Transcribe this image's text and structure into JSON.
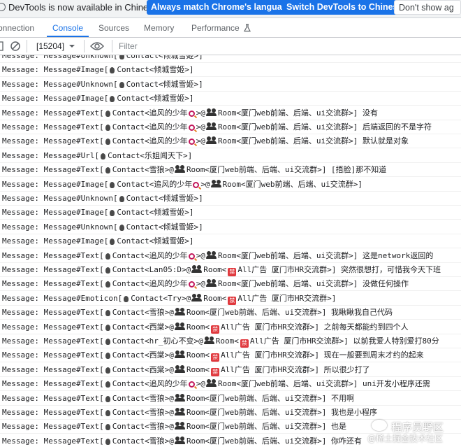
{
  "infobar": {
    "message": "DevTools is now available in Chinese!",
    "btn_match": "Always match Chrome's language",
    "btn_switch": "Switch DevTools to Chinese",
    "btn_dont": "Don't show ag"
  },
  "tabs": [
    {
      "label": "onnection"
    },
    {
      "label": "Console",
      "active": true
    },
    {
      "label": "Sources"
    },
    {
      "label": "Memory"
    },
    {
      "label": "Performance"
    }
  ],
  "toolbar": {
    "context": "[15204]",
    "filter_placeholder": "Filter"
  },
  "console_rows": [
    [
      {
        "t": "Message: Message#Unknown["
      },
      {
        "i": "bubble"
      },
      {
        "t": "Contact<倾城雪姬>]"
      }
    ],
    [
      {
        "t": "Message: Message#Image["
      },
      {
        "i": "bubble"
      },
      {
        "t": "Contact<倾城雪姬>]"
      }
    ],
    [
      {
        "t": "Message: Message#Unknown["
      },
      {
        "i": "bubble"
      },
      {
        "t": "Contact<倾城雪姬>]"
      }
    ],
    [
      {
        "t": "Message: Message#Image["
      },
      {
        "i": "bubble"
      },
      {
        "t": "Contact<倾城雪姬>]"
      }
    ],
    [
      {
        "t": "Message: Message#Text["
      },
      {
        "i": "bubble"
      },
      {
        "t": "Contact<追风的少年"
      },
      {
        "i": "mag"
      },
      {
        "t": ">@"
      },
      {
        "i": "group"
      },
      {
        "t": "Room<厦门web前端、后端、ui交流群>]     没有"
      }
    ],
    [
      {
        "t": "Message: Message#Text["
      },
      {
        "i": "bubble"
      },
      {
        "t": "Contact<追风的少年"
      },
      {
        "i": "mag"
      },
      {
        "t": ">@"
      },
      {
        "i": "group"
      },
      {
        "t": "Room<厦门web前端、后端、ui交流群>]     后端返回的不是字符"
      }
    ],
    [
      {
        "t": "Message: Message#Text["
      },
      {
        "i": "bubble"
      },
      {
        "t": "Contact<追风的少年"
      },
      {
        "i": "mag"
      },
      {
        "t": ">@"
      },
      {
        "i": "group"
      },
      {
        "t": "Room<厦门web前端、后端、ui交流群>]     默认就是对象"
      }
    ],
    [
      {
        "t": "Message: Message#Url["
      },
      {
        "i": "bubble"
      },
      {
        "t": "Contact<乐姐闻天下>]"
      }
    ],
    [
      {
        "t": "Message: Message#Text["
      },
      {
        "i": "bubble"
      },
      {
        "t": "Contact<雪狼>@"
      },
      {
        "i": "group"
      },
      {
        "t": "Room<厦门web前端、后端、ui交流群>]     [捂脸]那不知道"
      }
    ],
    [
      {
        "t": "Message: Message#Image["
      },
      {
        "i": "bubble"
      },
      {
        "t": "Contact<追风的少年"
      },
      {
        "i": "mag"
      },
      {
        "t": ">@"
      },
      {
        "i": "group"
      },
      {
        "t": "Room<厦门web前端、后端、ui交流群>]"
      }
    ],
    [
      {
        "t": "Message: Message#Unknown["
      },
      {
        "i": "bubble"
      },
      {
        "t": "Contact<倾城雪姬>]"
      }
    ],
    [
      {
        "t": "Message: Message#Image["
      },
      {
        "i": "bubble"
      },
      {
        "t": "Contact<倾城雪姬>]"
      }
    ],
    [
      {
        "t": "Message: Message#Unknown["
      },
      {
        "i": "bubble"
      },
      {
        "t": "Contact<倾城雪姬>]"
      }
    ],
    [
      {
        "t": "Message: Message#Image["
      },
      {
        "i": "bubble"
      },
      {
        "t": "Contact<倾城雪姬>]"
      }
    ],
    [
      {
        "t": "Message: Message#Text["
      },
      {
        "i": "bubble"
      },
      {
        "t": "Contact<追风的少年"
      },
      {
        "i": "mag"
      },
      {
        "t": ">@"
      },
      {
        "i": "group"
      },
      {
        "t": "Room<厦门web前端、后端、ui交流群>]     这是network返回的"
      }
    ],
    [
      {
        "t": "Message: Message#Text["
      },
      {
        "i": "bubble"
      },
      {
        "t": "Contact<Lan05:D>@"
      },
      {
        "i": "group"
      },
      {
        "t": "Room<"
      },
      {
        "i": "ban"
      },
      {
        "t": "All广告 厦门市HR交流群>]     突然很想打，可惜我今天下班"
      }
    ],
    [
      {
        "t": "Message: Message#Text["
      },
      {
        "i": "bubble"
      },
      {
        "t": "Contact<追风的少年"
      },
      {
        "i": "mag"
      },
      {
        "t": ">@"
      },
      {
        "i": "group"
      },
      {
        "t": "Room<厦门web前端、后端、ui交流群>]     没做任何操作"
      }
    ],
    [
      {
        "t": "Message: Message#Emoticon["
      },
      {
        "i": "bubble"
      },
      {
        "t": "Contact<Try>@"
      },
      {
        "i": "group"
      },
      {
        "t": "Room<"
      },
      {
        "i": "ban"
      },
      {
        "t": "All广告 厦门市HR交流群>]"
      }
    ],
    [
      {
        "t": "Message: Message#Text["
      },
      {
        "i": "bubble"
      },
      {
        "t": "Contact<雪狼>@"
      },
      {
        "i": "group"
      },
      {
        "t": "Room<厦门web前端、后端、ui交流群>]     我瞅瞅我自己代码"
      }
    ],
    [
      {
        "t": "Message: Message#Text["
      },
      {
        "i": "bubble"
      },
      {
        "t": "Contact<西棠>@"
      },
      {
        "i": "group"
      },
      {
        "t": "Room<"
      },
      {
        "i": "ban"
      },
      {
        "t": "All广告 厦门市HR交流群>]  之前每天都能约到四个人"
      }
    ],
    [
      {
        "t": "Message: Message#Text["
      },
      {
        "i": "bubble"
      },
      {
        "t": "Contact<hr_初心不变>@"
      },
      {
        "i": "group"
      },
      {
        "t": "Room<"
      },
      {
        "i": "ban"
      },
      {
        "t": "All广告 厦门市HR交流群>]     以前我爱人特别爱打80分"
      }
    ],
    [
      {
        "t": "Message: Message#Text["
      },
      {
        "i": "bubble"
      },
      {
        "t": "Contact<西棠>@"
      },
      {
        "i": "group"
      },
      {
        "t": "Room<"
      },
      {
        "i": "ban"
      },
      {
        "t": "All广告 厦门市HR交流群>]  现在一般要到周末才约的起来"
      }
    ],
    [
      {
        "t": "Message: Message#Text["
      },
      {
        "i": "bubble"
      },
      {
        "t": "Contact<西棠>@"
      },
      {
        "i": "group"
      },
      {
        "t": "Room<"
      },
      {
        "i": "ban"
      },
      {
        "t": "All广告 厦门市HR交流群>]  所以很少打了"
      }
    ],
    [
      {
        "t": "Message: Message#Text["
      },
      {
        "i": "bubble"
      },
      {
        "t": "Contact<追风的少年"
      },
      {
        "i": "mag"
      },
      {
        "t": ">@"
      },
      {
        "i": "group"
      },
      {
        "t": "Room<厦门web前端、后端、ui交流群>]     uni开发小程序还需"
      }
    ],
    [
      {
        "t": "Message: Message#Text["
      },
      {
        "i": "bubble"
      },
      {
        "t": "Contact<雪狼>@"
      },
      {
        "i": "group"
      },
      {
        "t": "Room<厦门web前端、后端、ui交流群>]     不用啊"
      }
    ],
    [
      {
        "t": "Message: Message#Text["
      },
      {
        "i": "bubble"
      },
      {
        "t": "Contact<雪狼>@"
      },
      {
        "i": "group"
      },
      {
        "t": "Room<厦门web前端、后端、ui交流群>]     我也是小程序"
      }
    ],
    [
      {
        "t": "Message: Message#Text["
      },
      {
        "i": "bubble"
      },
      {
        "t": "Contact<雪狼>@"
      },
      {
        "i": "group"
      },
      {
        "t": "Room<厦门web前端、后端、ui交流群>]     也是"
      }
    ],
    [
      {
        "t": "Message: Message#Text["
      },
      {
        "i": "bubble"
      },
      {
        "t": "Contact<雪狼>@"
      },
      {
        "i": "group"
      },
      {
        "t": "Room<厦门web前端、后端、ui交流群>]     你咋还有"
      }
    ]
  ],
  "watermark": {
    "line1": "程序员野区",
    "line2": "@稀土掘金技术社区"
  }
}
